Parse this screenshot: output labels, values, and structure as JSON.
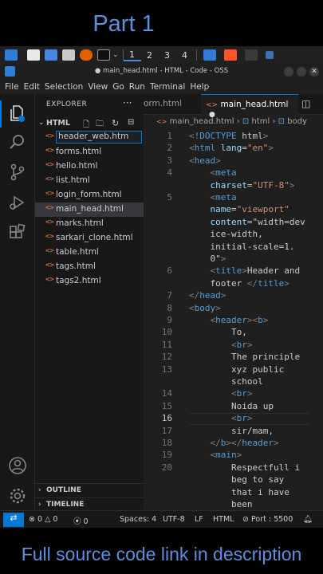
{
  "banner": {
    "top": "Part 1",
    "bottom": "Full source code link in description"
  },
  "taskbar": {
    "workspaces": [
      "1",
      "2",
      "3",
      "4"
    ],
    "active_workspace": "1"
  },
  "window": {
    "title": "● main_head.html - HTML - Code - OSS"
  },
  "menu": [
    "File",
    "Edit",
    "Selection",
    "View",
    "Go",
    "Run",
    "Terminal",
    "Help"
  ],
  "explorer": {
    "title": "EXPLORER",
    "folder": "HTML",
    "files": [
      {
        "icon": "<>",
        "name": "header_web.htm"
      },
      {
        "icon": "<>",
        "name": "forms.html"
      },
      {
        "icon": "<>",
        "name": "hello.html"
      },
      {
        "icon": "<>",
        "name": "list.html"
      },
      {
        "icon": "<>",
        "name": "login_form.html"
      },
      {
        "icon": "<>",
        "name": "main_head.html"
      },
      {
        "icon": "<>",
        "name": "marks.html"
      },
      {
        "icon": "<>",
        "name": "sarkari_clone.html"
      },
      {
        "icon": "<>",
        "name": "table.html"
      },
      {
        "icon": "<>",
        "name": "tags.html"
      },
      {
        "icon": "<>",
        "name": "tags2.html"
      }
    ],
    "sections": [
      "OUTLINE",
      "TIMELINE"
    ]
  },
  "editor": {
    "tabs": [
      {
        "label": "orm.html"
      },
      {
        "label": "main_head.html"
      }
    ],
    "breadcrumb": {
      "file": "main_head.html",
      "p1": "html",
      "p2": "body"
    },
    "lines": [
      {
        "n": "1",
        "t": "<!DOCTYPE html>"
      },
      {
        "n": "2",
        "t": "<html lang=\"en\">"
      },
      {
        "n": "3",
        "t": "<head>"
      },
      {
        "n": "4",
        "t": "    <meta"
      },
      {
        "n": "",
        "t": "    charset=\"UTF-8\">"
      },
      {
        "n": "5",
        "t": "    <meta"
      },
      {
        "n": "",
        "t": "    name=\"viewport\""
      },
      {
        "n": "",
        "t": "    content=\"width=dev"
      },
      {
        "n": "",
        "t": "    ice-width,"
      },
      {
        "n": "",
        "t": "    initial-scale=1."
      },
      {
        "n": "",
        "t": "    0\">"
      },
      {
        "n": "6",
        "t": "    <title>Header and"
      },
      {
        "n": "",
        "t": "    footer </title>"
      },
      {
        "n": "7",
        "t": "</head>"
      },
      {
        "n": "8",
        "t": "<body>"
      },
      {
        "n": "9",
        "t": "    <header><b>"
      },
      {
        "n": "10",
        "t": "        To,"
      },
      {
        "n": "11",
        "t": "        <br>"
      },
      {
        "n": "12",
        "t": "        The principle"
      },
      {
        "n": "13",
        "t": "        xyz public"
      },
      {
        "n": "",
        "t": "        school"
      },
      {
        "n": "14",
        "t": "        <br>"
      },
      {
        "n": "15",
        "t": "        Noida up"
      },
      {
        "n": "16",
        "t": "        <br>"
      },
      {
        "n": "17",
        "t": "        sir/mam,"
      },
      {
        "n": "18",
        "t": "    </b></header>"
      },
      {
        "n": "19",
        "t": "    <main>"
      },
      {
        "n": "20",
        "t": "        Respectfull i"
      },
      {
        "n": "",
        "t": "        beg to say"
      },
      {
        "n": "",
        "t": "        that i have"
      },
      {
        "n": "",
        "t": "        been"
      }
    ]
  },
  "status": {
    "errors": "0",
    "warnings": "0",
    "ports_count": "0",
    "spaces": "Spaces: 4",
    "encoding": "UTF-8",
    "eol": "LF",
    "language": "HTML",
    "port": "Port : 5500"
  }
}
